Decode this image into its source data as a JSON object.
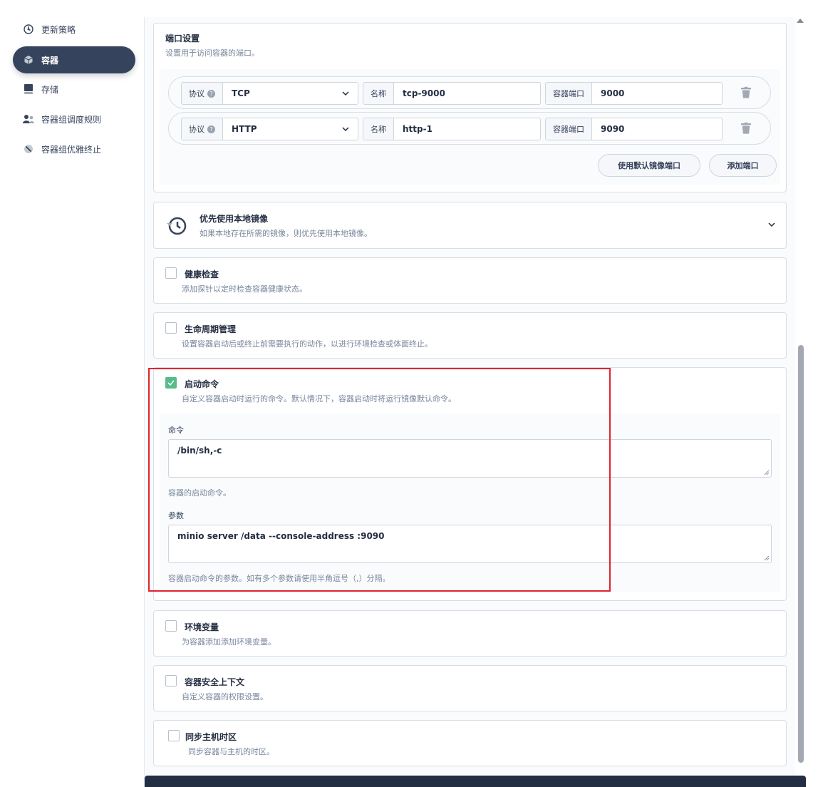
{
  "sidebar": {
    "items": [
      {
        "label": "更新策略",
        "icon": "update-strategy-icon"
      },
      {
        "label": "容器",
        "icon": "container-icon",
        "active": true
      },
      {
        "label": "存储",
        "icon": "storage-icon"
      },
      {
        "label": "容器组调度规则",
        "icon": "pod-scheduling-icon"
      },
      {
        "label": "容器组优雅终止",
        "icon": "graceful-termination-icon"
      }
    ]
  },
  "ports": {
    "title": "端口设置",
    "desc": "设置用于访问容器的端口。",
    "protocol_label": "协议",
    "name_label": "名称",
    "container_port_label": "容器端口",
    "rows": [
      {
        "protocol": "TCP",
        "name": "tcp-9000",
        "port": "9000"
      },
      {
        "protocol": "HTTP",
        "name": "http-1",
        "port": "9090"
      }
    ],
    "use_default_btn": "使用默认镜像端口",
    "add_port_btn": "添加端口"
  },
  "local_image": {
    "title": "优先使用本地镜像",
    "desc": "如果本地存在所需的镜像，则优先使用本地镜像。"
  },
  "health_check": {
    "title": "健康检查",
    "desc": "添加探针以定时检查容器健康状态。"
  },
  "lifecycle": {
    "title": "生命周期管理",
    "desc": "设置容器启动后或终止前需要执行的动作，以进行环境检查或体面终止。"
  },
  "startup_command": {
    "title": "启动命令",
    "desc": "自定义容器启动时运行的命令。默认情况下，容器启动时将运行镜像默认命令。",
    "command_label": "命令",
    "command_value": "/bin/sh,-c",
    "command_hint": "容器的启动命令。",
    "args_label": "参数",
    "args_value": "minio server /data --console-address :9090",
    "args_hint": "容器启动命令的参数。如有多个参数请使用半角逗号（,）分隔。"
  },
  "env": {
    "title": "环境变量",
    "desc": "为容器添加添加环境变量。"
  },
  "security_context": {
    "title": "容器安全上下文",
    "desc": "自定义容器的权限设置。"
  },
  "sync_timezone": {
    "title": "同步主机时区",
    "desc": "同步容器与主机的时区。"
  },
  "colors": {
    "accent": "#36435c",
    "checked": "#55bc8a",
    "highlight": "#e0242f"
  }
}
